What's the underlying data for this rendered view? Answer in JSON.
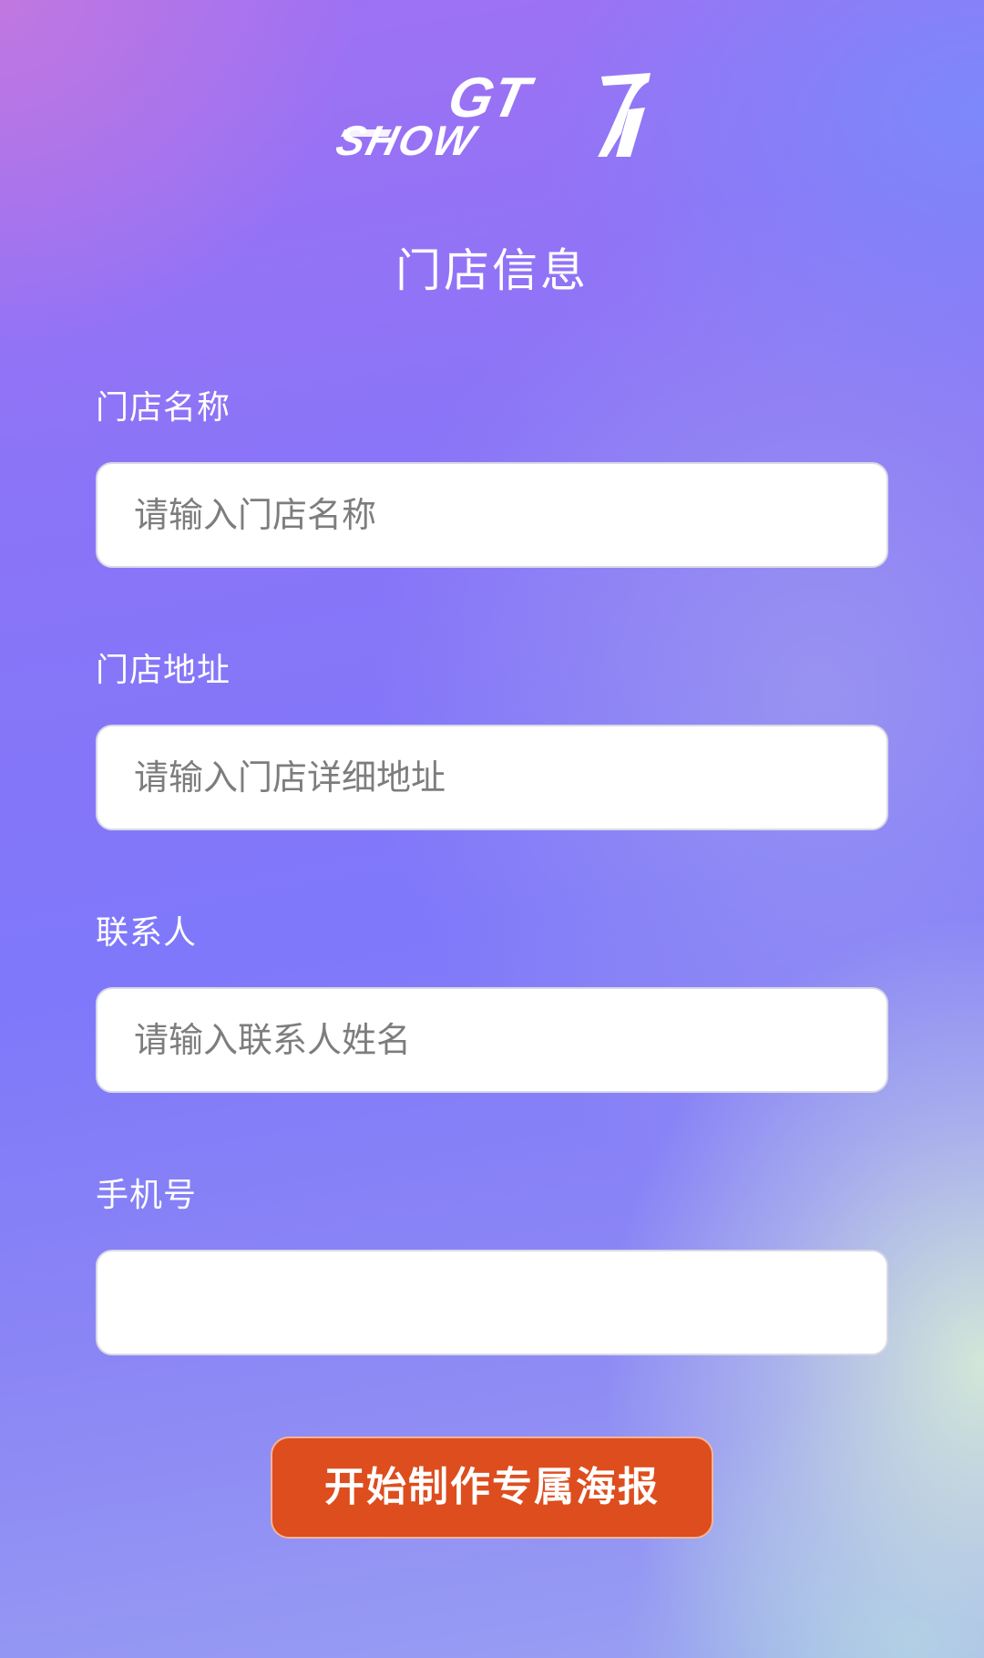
{
  "logo": {
    "text_top": "GT",
    "text_bottom": "SHOW",
    "icon": "gt-show-logo"
  },
  "header": {
    "title": "门店信息"
  },
  "form": {
    "store_name": {
      "label": "门店名称",
      "placeholder": "请输入门店名称",
      "value": ""
    },
    "store_address": {
      "label": "门店地址",
      "placeholder": "请输入门店详细地址",
      "value": ""
    },
    "contact": {
      "label": "联系人",
      "placeholder": "请输入联系人姓名",
      "value": ""
    },
    "phone": {
      "label": "手机号",
      "placeholder": "",
      "value": ""
    }
  },
  "actions": {
    "submit_label": "开始制作专属海报",
    "submit_color": "#dd4d1e"
  }
}
